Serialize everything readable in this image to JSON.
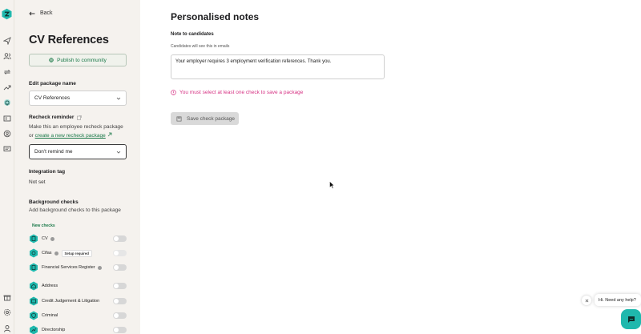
{
  "nav": {
    "back_label": "Back",
    "icons": [
      "send-icon",
      "users-icon",
      "repeat-icon",
      "trending-icon",
      "bell-icon",
      "id-card-icon",
      "globe-icon",
      "message-icon",
      "gift-icon",
      "settings-icon",
      "profile-icon"
    ]
  },
  "package": {
    "title": "CV References",
    "publish_label": "Publish to community",
    "edit_name_label": "Edit package name",
    "name_value": "CV References",
    "recheck_label": "Recheck reminder",
    "recheck_text": "Make this an employee recheck package",
    "recheck_or": "or ",
    "recheck_link": "create a new recheck package",
    "remind_value": "Don't remind me",
    "integration_label": "Integration tag",
    "integration_value": "Not set",
    "bg_label": "Background checks",
    "bg_sub": "Add background checks to this package",
    "new_checks_label": "New checks"
  },
  "checks": [
    {
      "name": "CV",
      "info": true,
      "badge": ""
    },
    {
      "name": "Cifas",
      "info": true,
      "badge": "Setup required"
    },
    {
      "name": "Financial Services Register",
      "info": true,
      "badge": ""
    },
    {
      "name": "Address",
      "info": false,
      "badge": ""
    },
    {
      "name": "Credit Judgement & Litigation",
      "info": false,
      "badge": ""
    },
    {
      "name": "Criminal",
      "info": false,
      "badge": ""
    },
    {
      "name": "Directorship",
      "info": false,
      "badge": ""
    }
  ],
  "main": {
    "title": "Personalised notes",
    "note_label": "Note to candidates",
    "note_sub": "Candidates will see this in emails",
    "note_value": "Your employer requires 3 employment verification references. Thank you.",
    "error_text": "You must select at least one check to save a package",
    "save_label": "Save check package"
  },
  "chat": {
    "bubble_text": "Hi. Need any help?"
  },
  "colors": {
    "brand": "#1fb8ad",
    "link": "#1c7a4a",
    "error": "#d63384",
    "panel_bg": "#f5f2ee"
  }
}
